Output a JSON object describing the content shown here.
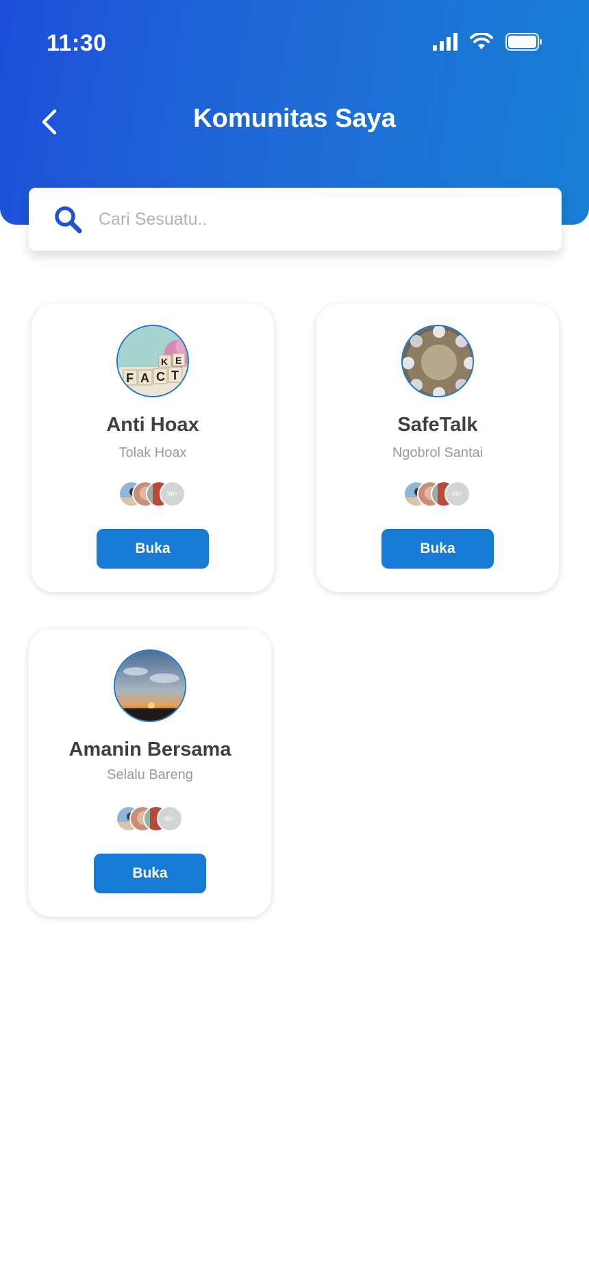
{
  "status_bar": {
    "time": "11:30"
  },
  "header": {
    "title": "Komunitas Saya"
  },
  "search": {
    "placeholder": "Cari Sesuatu.."
  },
  "communities": [
    {
      "name": "Anti Hoax",
      "description": "Tolak Hoax",
      "member_count": "99+",
      "button_label": "Buka",
      "image_letters": "FACT"
    },
    {
      "name": "SafeTalk",
      "description": "Ngobrol Santai",
      "member_count": "99+",
      "button_label": "Buka"
    },
    {
      "name": "Amanin Bersama",
      "description": "Selalu Bareng",
      "member_count": "99+",
      "button_label": "Buka"
    }
  ],
  "colors": {
    "accent": "#177ad4",
    "header_start": "#1d4fd8",
    "header_end": "#177fd4"
  }
}
